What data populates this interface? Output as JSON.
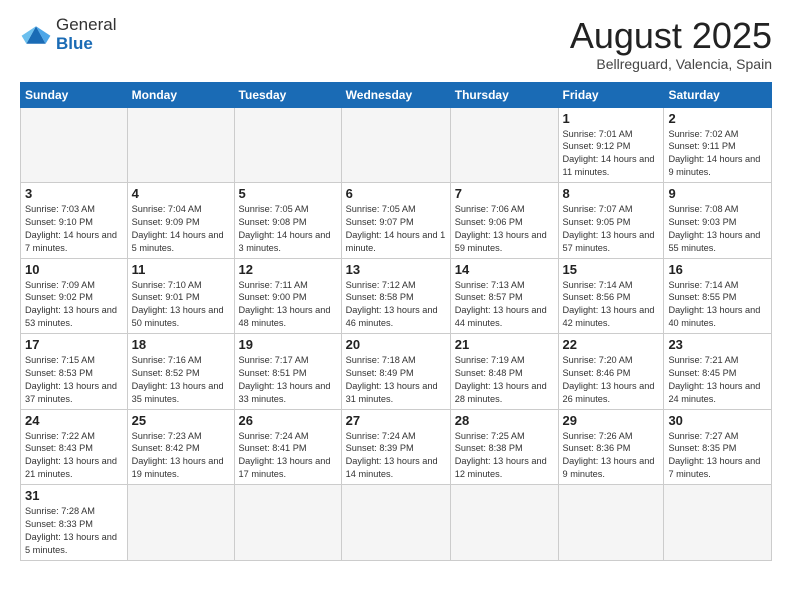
{
  "logo": {
    "text_general": "General",
    "text_blue": "Blue"
  },
  "header": {
    "month": "August 2025",
    "location": "Bellreguard, Valencia, Spain"
  },
  "weekdays": [
    "Sunday",
    "Monday",
    "Tuesday",
    "Wednesday",
    "Thursday",
    "Friday",
    "Saturday"
  ],
  "weeks": [
    [
      {
        "day": "",
        "info": ""
      },
      {
        "day": "",
        "info": ""
      },
      {
        "day": "",
        "info": ""
      },
      {
        "day": "",
        "info": ""
      },
      {
        "day": "",
        "info": ""
      },
      {
        "day": "1",
        "info": "Sunrise: 7:01 AM\nSunset: 9:12 PM\nDaylight: 14 hours and 11 minutes."
      },
      {
        "day": "2",
        "info": "Sunrise: 7:02 AM\nSunset: 9:11 PM\nDaylight: 14 hours and 9 minutes."
      }
    ],
    [
      {
        "day": "3",
        "info": "Sunrise: 7:03 AM\nSunset: 9:10 PM\nDaylight: 14 hours and 7 minutes."
      },
      {
        "day": "4",
        "info": "Sunrise: 7:04 AM\nSunset: 9:09 PM\nDaylight: 14 hours and 5 minutes."
      },
      {
        "day": "5",
        "info": "Sunrise: 7:05 AM\nSunset: 9:08 PM\nDaylight: 14 hours and 3 minutes."
      },
      {
        "day": "6",
        "info": "Sunrise: 7:05 AM\nSunset: 9:07 PM\nDaylight: 14 hours and 1 minute."
      },
      {
        "day": "7",
        "info": "Sunrise: 7:06 AM\nSunset: 9:06 PM\nDaylight: 13 hours and 59 minutes."
      },
      {
        "day": "8",
        "info": "Sunrise: 7:07 AM\nSunset: 9:05 PM\nDaylight: 13 hours and 57 minutes."
      },
      {
        "day": "9",
        "info": "Sunrise: 7:08 AM\nSunset: 9:03 PM\nDaylight: 13 hours and 55 minutes."
      }
    ],
    [
      {
        "day": "10",
        "info": "Sunrise: 7:09 AM\nSunset: 9:02 PM\nDaylight: 13 hours and 53 minutes."
      },
      {
        "day": "11",
        "info": "Sunrise: 7:10 AM\nSunset: 9:01 PM\nDaylight: 13 hours and 50 minutes."
      },
      {
        "day": "12",
        "info": "Sunrise: 7:11 AM\nSunset: 9:00 PM\nDaylight: 13 hours and 48 minutes."
      },
      {
        "day": "13",
        "info": "Sunrise: 7:12 AM\nSunset: 8:58 PM\nDaylight: 13 hours and 46 minutes."
      },
      {
        "day": "14",
        "info": "Sunrise: 7:13 AM\nSunset: 8:57 PM\nDaylight: 13 hours and 44 minutes."
      },
      {
        "day": "15",
        "info": "Sunrise: 7:14 AM\nSunset: 8:56 PM\nDaylight: 13 hours and 42 minutes."
      },
      {
        "day": "16",
        "info": "Sunrise: 7:14 AM\nSunset: 8:55 PM\nDaylight: 13 hours and 40 minutes."
      }
    ],
    [
      {
        "day": "17",
        "info": "Sunrise: 7:15 AM\nSunset: 8:53 PM\nDaylight: 13 hours and 37 minutes."
      },
      {
        "day": "18",
        "info": "Sunrise: 7:16 AM\nSunset: 8:52 PM\nDaylight: 13 hours and 35 minutes."
      },
      {
        "day": "19",
        "info": "Sunrise: 7:17 AM\nSunset: 8:51 PM\nDaylight: 13 hours and 33 minutes."
      },
      {
        "day": "20",
        "info": "Sunrise: 7:18 AM\nSunset: 8:49 PM\nDaylight: 13 hours and 31 minutes."
      },
      {
        "day": "21",
        "info": "Sunrise: 7:19 AM\nSunset: 8:48 PM\nDaylight: 13 hours and 28 minutes."
      },
      {
        "day": "22",
        "info": "Sunrise: 7:20 AM\nSunset: 8:46 PM\nDaylight: 13 hours and 26 minutes."
      },
      {
        "day": "23",
        "info": "Sunrise: 7:21 AM\nSunset: 8:45 PM\nDaylight: 13 hours and 24 minutes."
      }
    ],
    [
      {
        "day": "24",
        "info": "Sunrise: 7:22 AM\nSunset: 8:43 PM\nDaylight: 13 hours and 21 minutes."
      },
      {
        "day": "25",
        "info": "Sunrise: 7:23 AM\nSunset: 8:42 PM\nDaylight: 13 hours and 19 minutes."
      },
      {
        "day": "26",
        "info": "Sunrise: 7:24 AM\nSunset: 8:41 PM\nDaylight: 13 hours and 17 minutes."
      },
      {
        "day": "27",
        "info": "Sunrise: 7:24 AM\nSunset: 8:39 PM\nDaylight: 13 hours and 14 minutes."
      },
      {
        "day": "28",
        "info": "Sunrise: 7:25 AM\nSunset: 8:38 PM\nDaylight: 13 hours and 12 minutes."
      },
      {
        "day": "29",
        "info": "Sunrise: 7:26 AM\nSunset: 8:36 PM\nDaylight: 13 hours and 9 minutes."
      },
      {
        "day": "30",
        "info": "Sunrise: 7:27 AM\nSunset: 8:35 PM\nDaylight: 13 hours and 7 minutes."
      }
    ],
    [
      {
        "day": "31",
        "info": "Sunrise: 7:28 AM\nSunset: 8:33 PM\nDaylight: 13 hours and 5 minutes."
      },
      {
        "day": "",
        "info": ""
      },
      {
        "day": "",
        "info": ""
      },
      {
        "day": "",
        "info": ""
      },
      {
        "day": "",
        "info": ""
      },
      {
        "day": "",
        "info": ""
      },
      {
        "day": "",
        "info": ""
      }
    ]
  ]
}
